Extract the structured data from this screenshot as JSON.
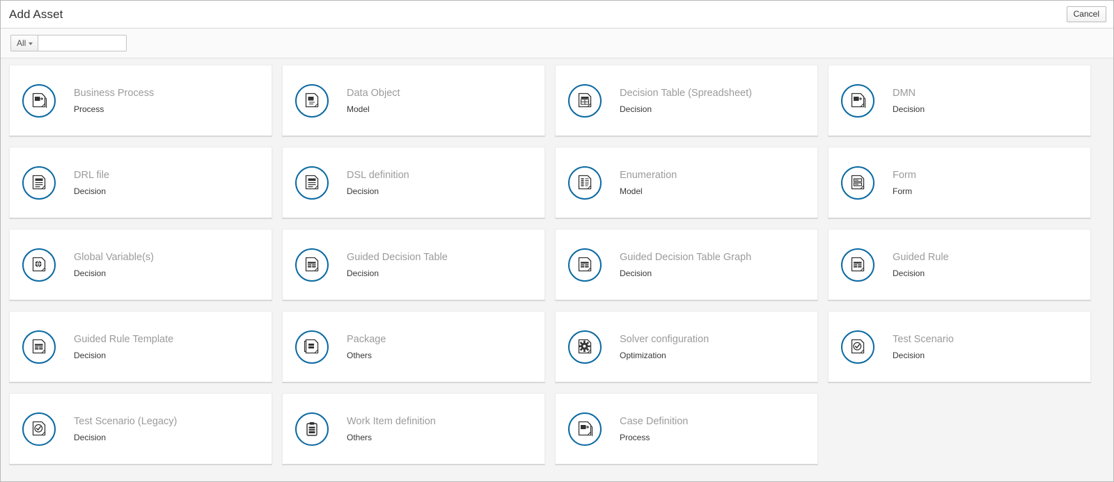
{
  "header": {
    "title": "Add Asset",
    "cancel_label": "Cancel"
  },
  "toolbar": {
    "filter_label": "All",
    "filter_icon": "chevron-down-icon",
    "search_value": "",
    "search_placeholder": ""
  },
  "assets": [
    {
      "title": "Business Process",
      "category": "Process",
      "icon": "process-document-icon"
    },
    {
      "title": "Data Object",
      "category": "Model",
      "icon": "data-object-document-icon"
    },
    {
      "title": "Decision Table (Spreadsheet)",
      "category": "Decision",
      "icon": "spreadsheet-document-icon"
    },
    {
      "title": "DMN",
      "category": "Decision",
      "icon": "process-document-icon"
    },
    {
      "title": "DRL file",
      "category": "Decision",
      "icon": "rule-document-icon"
    },
    {
      "title": "DSL definition",
      "category": "Decision",
      "icon": "rule-document-icon"
    },
    {
      "title": "Enumeration",
      "category": "Model",
      "icon": "lined-document-icon"
    },
    {
      "title": "Form",
      "category": "Form",
      "icon": "form-document-icon"
    },
    {
      "title": "Global Variable(s)",
      "category": "Decision",
      "icon": "globe-document-icon"
    },
    {
      "title": "Guided Decision Table",
      "category": "Decision",
      "icon": "table-document-icon"
    },
    {
      "title": "Guided Decision Table Graph",
      "category": "Decision",
      "icon": "table-document-icon"
    },
    {
      "title": "Guided Rule",
      "category": "Decision",
      "icon": "table-document-icon"
    },
    {
      "title": "Guided Rule Template",
      "category": "Decision",
      "icon": "table-document-icon"
    },
    {
      "title": "Package",
      "category": "Others",
      "icon": "package-document-icon"
    },
    {
      "title": "Solver configuration",
      "category": "Optimization",
      "icon": "gear-document-icon"
    },
    {
      "title": "Test Scenario",
      "category": "Decision",
      "icon": "check-document-icon"
    },
    {
      "title": "Test Scenario (Legacy)",
      "category": "Decision",
      "icon": "check-document-icon"
    },
    {
      "title": "Work Item definition",
      "category": "Others",
      "icon": "clipboard-icon"
    },
    {
      "title": "Case Definition",
      "category": "Process",
      "icon": "process-document-icon"
    }
  ],
  "colors": {
    "accent": "#0b6aa2",
    "icon_stroke": "#333333",
    "title_text": "#9b9b9b",
    "category_text": "#363636",
    "grid_background": "#f4f4f4",
    "card_background": "#ffffff"
  }
}
